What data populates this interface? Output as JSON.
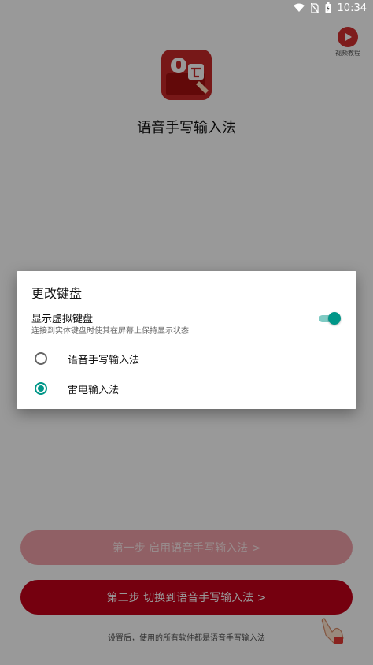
{
  "status_bar": {
    "time": "10:34",
    "icons": [
      "wifi-icon",
      "no-sim-icon",
      "battery-icon"
    ]
  },
  "app": {
    "video_button_label": "视频教程",
    "title": "语音手写输入法",
    "step1_button": "第一步 启用语音手写输入法 >",
    "step2_button": "第二步 切换到语音手写输入法 >",
    "footer_note": "设置后，使用的所有软件都是语音手写输入法",
    "colors": {
      "brand": "#c4001a",
      "step1_disabled": "#f0a0a8"
    }
  },
  "dialog": {
    "title": "更改键盘",
    "toggle_label": "显示虚拟键盘",
    "toggle_sublabel": "连接到实体键盘时使其在屏幕上保持显示状态",
    "toggle_on": true,
    "options": [
      {
        "label": "语音手写输入法",
        "selected": false
      },
      {
        "label": "雷电输入法",
        "selected": true
      }
    ],
    "accent_color": "#009688"
  }
}
